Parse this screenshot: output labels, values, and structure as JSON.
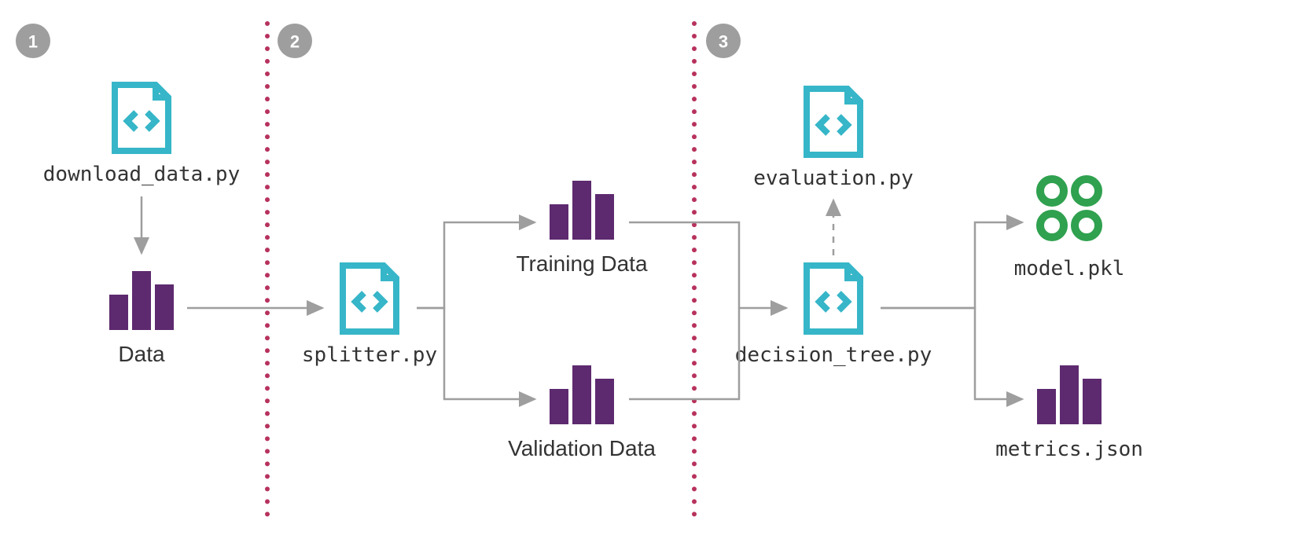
{
  "diagram": {
    "stages": {
      "s1": {
        "badge": "1"
      },
      "s2": {
        "badge": "2"
      },
      "s3": {
        "badge": "3"
      }
    },
    "nodes": {
      "download": {
        "label": "download_data.py",
        "type": "code"
      },
      "data": {
        "label": "Data",
        "type": "bars"
      },
      "splitter": {
        "label": "splitter.py",
        "type": "code"
      },
      "training": {
        "label": "Training Data",
        "type": "bars"
      },
      "validation": {
        "label": "Validation Data",
        "type": "bars"
      },
      "evaluation": {
        "label": "evaluation.py",
        "type": "code"
      },
      "decision_tree": {
        "label": "decision_tree.py",
        "type": "code"
      },
      "model": {
        "label": "model.pkl",
        "type": "pkl"
      },
      "metrics": {
        "label": "metrics.json",
        "type": "bars"
      }
    },
    "colors": {
      "code": "#36b6c8",
      "bars": "#5d2a6f",
      "circles": "#2fa14f",
      "arrow": "#9e9e9e",
      "divider": "#b7325d",
      "badge": "#9e9e9e"
    }
  }
}
